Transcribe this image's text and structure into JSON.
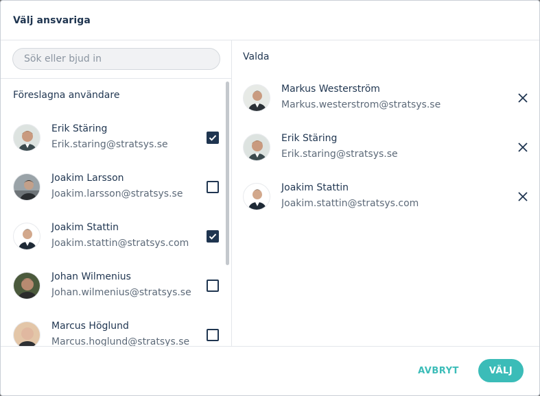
{
  "dialog": {
    "title": "Välj ansvariga"
  },
  "search": {
    "placeholder": "Sök eller bjud in",
    "value": ""
  },
  "suggested": {
    "label": "Föreslagna användare",
    "users": [
      {
        "name": "Erik Stäring",
        "email": "Erik.staring@stratsys.se",
        "checked": true
      },
      {
        "name": "Joakim Larsson",
        "email": "Joakim.larsson@stratsys.se",
        "checked": false
      },
      {
        "name": "Joakim Stattin",
        "email": "Joakim.stattin@stratsys.com",
        "checked": true
      },
      {
        "name": "Johan Wilmenius",
        "email": "Johan.wilmenius@stratsys.se",
        "checked": false
      },
      {
        "name": "Marcus Höglund",
        "email": "Marcus.hoglund@stratsys.se",
        "checked": false
      }
    ]
  },
  "selected": {
    "label": "Valda",
    "users": [
      {
        "name": "Markus Westerström",
        "email": "Markus.westerstrom@stratsys.se"
      },
      {
        "name": "Erik Stäring",
        "email": "Erik.staring@stratsys.se"
      },
      {
        "name": "Joakim Stattin",
        "email": "Joakim.stattin@stratsys.com"
      }
    ]
  },
  "footer": {
    "cancel_label": "AVBRYT",
    "ok_label": "VÄLJ"
  },
  "colors": {
    "accent": "#3bbcb8",
    "text_dark": "#1f3550",
    "text_muted": "#5d6a79"
  },
  "icons": {
    "avatar": "user-avatar-photo",
    "check": "check-icon",
    "remove": "close-icon"
  }
}
